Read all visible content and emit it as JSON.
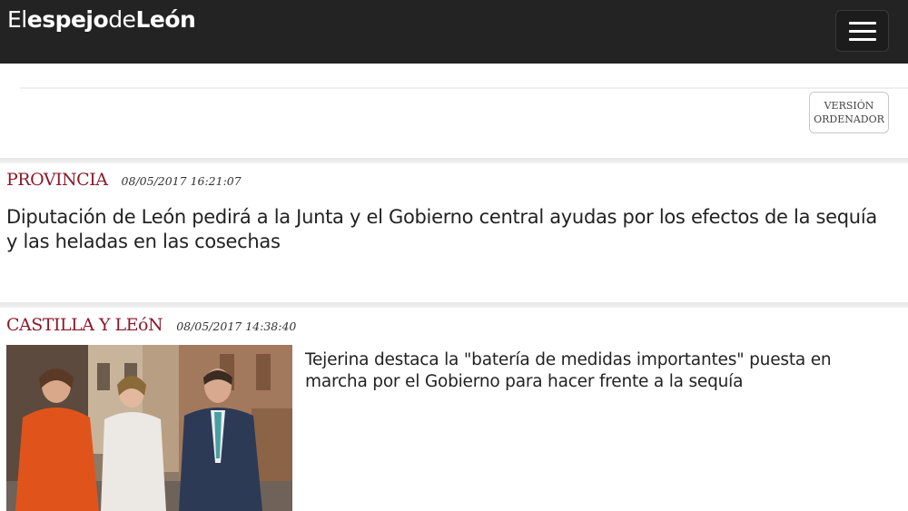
{
  "header": {
    "logo": {
      "part1": "El",
      "part2": "espejo",
      "part3": "de",
      "part4": "León"
    },
    "menu_icon": "hamburger-menu-icon"
  },
  "toolbar": {
    "version_line1": "VERSIÓN",
    "version_line2": "ORDENADOR"
  },
  "articles": [
    {
      "category": "PROVINCIA",
      "timestamp": "08/05/2017 16:21:07",
      "headline": "Diputación de León pedirá a la Junta y el Gobierno central ayudas por los efectos de la sequía y las heladas en las cosechas"
    },
    {
      "category": "CASTILLA Y LEóN",
      "timestamp": "08/05/2017 14:38:40",
      "headline": "Tejerina destaca la \"batería de medidas importantes\" puesta en marcha por el Gobierno para hacer frente a la sequía"
    }
  ],
  "colors": {
    "topbar": "#232323",
    "category": "#8b1a2b"
  }
}
